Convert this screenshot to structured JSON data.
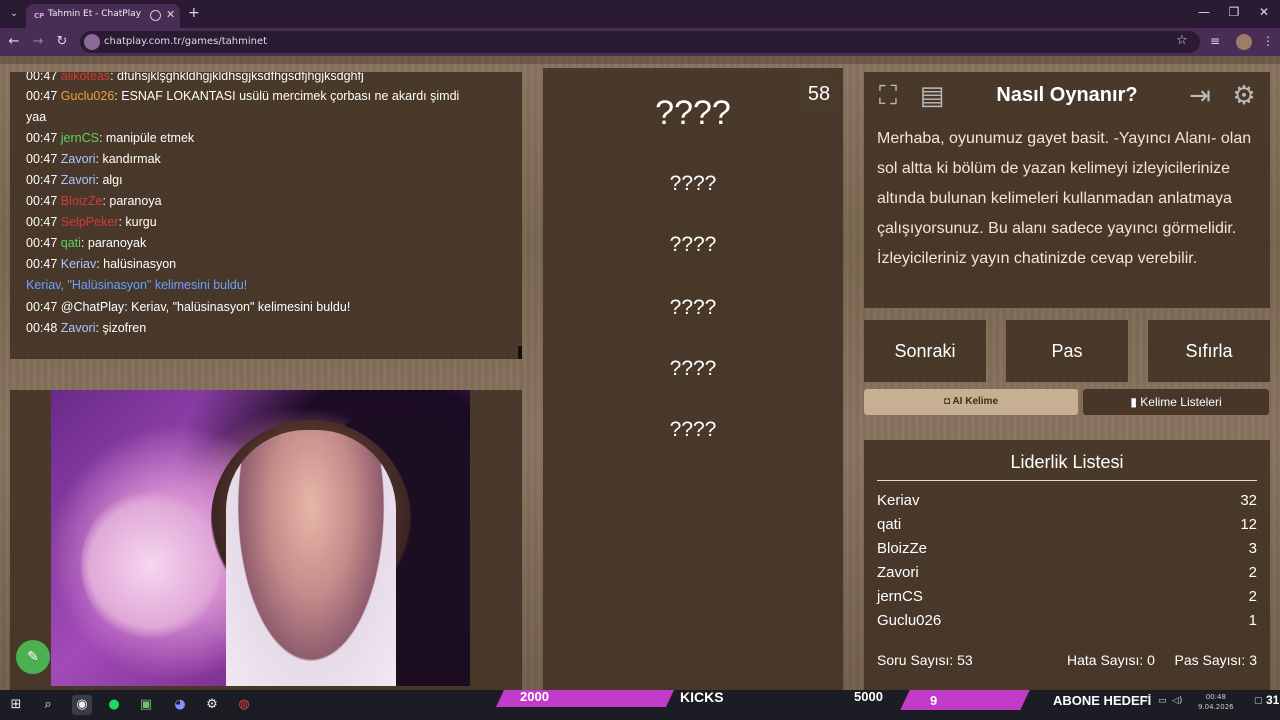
{
  "browser": {
    "tab_title": "Tahmin Et - ChatPlay",
    "tab_favicon": "CP",
    "url": "chatplay.com.tr/games/tahminet"
  },
  "chat": {
    "messages": [
      {
        "time": "00:47",
        "user": "alikoteas",
        "user_color": "#d23a3a",
        "text": ": dfuhsjklşghkldhgjkldhsgjksdfhgsdfjhgjksdghfj"
      },
      {
        "time": "00:47",
        "user": "Guclu026",
        "user_color": "#e8a23a",
        "text": ": ESNAF LOKANTASI usülü mercimek çorbası ne akardı şimdi"
      },
      {
        "time": "",
        "user": "",
        "user_color": "#ffffff",
        "text": "yaa"
      },
      {
        "time": "00:47",
        "user": "jernCS",
        "user_color": "#5fd35f",
        "text": ": manipüle etmek"
      },
      {
        "time": "00:47",
        "user": "Zavori",
        "user_color": "#a8c8ff",
        "text": ": kandırmak"
      },
      {
        "time": "00:47",
        "user": "Zavori",
        "user_color": "#a8c8ff",
        "text": ": algı"
      },
      {
        "time": "00:47",
        "user": "BloizZe",
        "user_color": "#d23a3a",
        "text": ": paranoya"
      },
      {
        "time": "00:47",
        "user": "SelpPeker",
        "user_color": "#d23a3a",
        "text": ": kurgu"
      },
      {
        "time": "00:47",
        "user": "qati",
        "user_color": "#5fd35f",
        "text": ": paranoyak"
      },
      {
        "time": "00:47",
        "user": "Keriav",
        "user_color": "#a8c8ff",
        "text": ": halüsinasyon"
      },
      {
        "time": "",
        "user": "Keriav, \"Halüsinasyon\"",
        "user_color": "#6aa0ff",
        "text": " kelimesini buldu!"
      },
      {
        "time": "00:47",
        "user": "@ChatPlay",
        "user_color": "#ffffff",
        "text": ": Keriav, \"halüsinasyon\" kelimesini buldu!"
      },
      {
        "time": "00:48",
        "user": "Zavori",
        "user_color": "#a8c8ff",
        "text": ": şizofren"
      }
    ]
  },
  "game": {
    "timer": "58",
    "main_word": "????",
    "words": [
      "????",
      "????",
      "????",
      "????",
      "????"
    ]
  },
  "help": {
    "title": "Nasıl Oynanır?",
    "text": "Merhaba, oyunumuz gayet basit. -Yayıncı Alanı- olan sol altta ki bölüm de yazan kelimeyi izleyicilerinize altında bulunan kelimeleri kullanmadan anlatmaya çalışıyorsunuz. Bu alanı sadece yayıncı görmelidir. İzleyicileriniz yayın chatinizde cevap verebilir."
  },
  "controls": {
    "next": "Sonraki",
    "pass": "Pas",
    "reset": "Sıfırla",
    "ai_word": "AI Kelime",
    "word_lists": "Kelime Listeleri"
  },
  "leaderboard": {
    "title": "Liderlik Listesi",
    "rows": [
      {
        "name": "Keriav",
        "score": "32"
      },
      {
        "name": "qati",
        "score": "12"
      },
      {
        "name": "BloizZe",
        "score": "3"
      },
      {
        "name": "Zavori",
        "score": "2"
      },
      {
        "name": "jernCS",
        "score": "2"
      },
      {
        "name": "Guclu026",
        "score": "1"
      }
    ],
    "question_count": "Soru Sayısı: 53",
    "error_count": "Hata Sayısı: 0",
    "pass_count": "Pas Sayısı: 3"
  },
  "overlay": {
    "goal_left": "2000",
    "kicks": "KICKS",
    "goal_right": "5000",
    "sub_count": "9",
    "sub_goal": "ABONE HEDEFİ"
  },
  "taskbar": {
    "time": "00:48",
    "date": "9.04.2026",
    "edge_text": "31"
  },
  "colors": {
    "accent": "#c23bc8",
    "wood_panel": "#443426",
    "ai_button": "#c7b091"
  }
}
